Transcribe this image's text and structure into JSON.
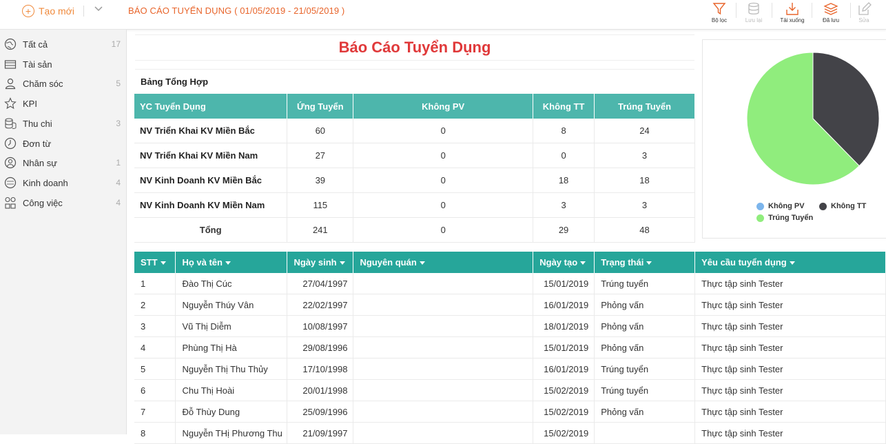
{
  "header": {
    "new_label": "Tạo mới",
    "report_title": "BÁO CÁO TUYỂN DỤNG ( 01/05/2019 - 21/05/2019 )",
    "tools": [
      {
        "label": "Bộ lọc",
        "icon": "filter-icon",
        "enabled": true
      },
      {
        "label": "Lưu lại",
        "icon": "database-icon",
        "enabled": false
      },
      {
        "label": "Tải xuống",
        "icon": "download-icon",
        "enabled": true
      },
      {
        "label": "Đã lưu",
        "icon": "layers-icon",
        "enabled": true
      },
      {
        "label": "Sửa",
        "icon": "edit-icon",
        "enabled": false
      }
    ]
  },
  "sidebar": {
    "items": [
      {
        "label": "Tất cả",
        "count": "17",
        "icon": "globe-icon"
      },
      {
        "label": "Tài sản",
        "count": "",
        "icon": "cabinet-icon"
      },
      {
        "label": "Chăm sóc",
        "count": "5",
        "icon": "user-icon"
      },
      {
        "label": "KPI",
        "count": "",
        "icon": "star-icon"
      },
      {
        "label": "Thu chi",
        "count": "3",
        "icon": "coins-icon"
      },
      {
        "label": "Đơn từ",
        "count": "",
        "icon": "clock-icon"
      },
      {
        "label": "Nhân sự",
        "count": "1",
        "icon": "person-circle-icon"
      },
      {
        "label": "Kinh doanh",
        "count": "4",
        "icon": "sale-badge-icon"
      },
      {
        "label": "Công việc",
        "count": "4",
        "icon": "tasks-icon"
      }
    ]
  },
  "report": {
    "title": "Báo Cáo Tuyển Dụng",
    "summary_title": "Bảng Tổng Hợp",
    "summary": {
      "headers": [
        "YC Tuyển Dụng",
        "Ứng Tuyển",
        "Không PV",
        "Không TT",
        "Trúng Tuyển"
      ],
      "rows": [
        [
          "NV Triển Khai KV Miền Bắc",
          "60",
          "0",
          "8",
          "24"
        ],
        [
          "NV Triển Khai KV Miền Nam",
          "27",
          "0",
          "0",
          "3"
        ],
        [
          "NV Kinh Doanh KV Miền Bắc",
          "39",
          "0",
          "18",
          "18"
        ],
        [
          "NV Kinh Doanh KV Miền Nam",
          "115",
          "0",
          "3",
          "3"
        ]
      ],
      "total": [
        "Tổng",
        "241",
        "0",
        "29",
        "48"
      ]
    },
    "details": {
      "headers": [
        "STT",
        "Họ và tên",
        "Ngày sinh",
        "Nguyên quán",
        "Ngày tạo",
        "Trạng thái",
        "Yêu cầu tuyển dụng"
      ],
      "rows": [
        [
          "1",
          "Đào Thị Cúc",
          "27/04/1997",
          "",
          "15/01/2019",
          "Trúng tuyển",
          "Thực tập sinh Tester"
        ],
        [
          "2",
          "Nguyễn Thúy Vân",
          "22/02/1997",
          "",
          "16/01/2019",
          "Phỏng vấn",
          "Thực tập sinh Tester"
        ],
        [
          "3",
          "Vũ Thị Diễm",
          "10/08/1997",
          "",
          "18/01/2019",
          "Phỏng vấn",
          "Thực tập sinh Tester"
        ],
        [
          "4",
          "Phùng Thị Hà",
          "29/08/1996",
          "",
          "15/01/2019",
          "Phỏng vấn",
          "Thực tập sinh Tester"
        ],
        [
          "5",
          "Nguyễn Thị Thu Thủy",
          "17/10/1998",
          "",
          "16/01/2019",
          "Trúng tuyển",
          "Thực tập sinh Tester"
        ],
        [
          "6",
          "Chu Thị Hoài",
          "20/01/1998",
          "",
          "15/02/2019",
          "Trúng tuyển",
          "Thực tập sinh Tester"
        ],
        [
          "7",
          "Đỗ Thùy Dung",
          "25/09/1996",
          "",
          "15/02/2019",
          "Phỏng vấn",
          "Thực tập sinh Tester"
        ],
        [
          "8",
          "Nguyễn THị Phương Thu",
          "21/09/1997",
          "",
          "15/02/2019",
          "",
          "Thực tập sinh Tester"
        ]
      ]
    }
  },
  "chart_data": {
    "type": "pie",
    "title": "",
    "categories": [
      "Không PV",
      "Không TT",
      "Trúng Tuyển"
    ],
    "values": [
      0,
      29,
      48
    ],
    "colors": [
      "#7cb5ec",
      "#434348",
      "#90ed7d"
    ],
    "legend_position": "bottom"
  }
}
